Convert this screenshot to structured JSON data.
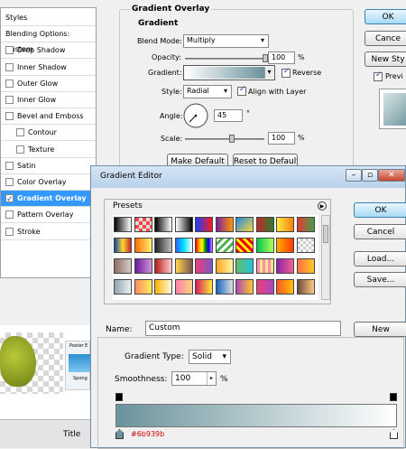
{
  "styles_panel": {
    "items": [
      {
        "label": "Styles",
        "checked": null
      },
      {
        "label": "Blending Options: Custom",
        "checked": null
      },
      {
        "label": "Drop Shadow",
        "checked": false
      },
      {
        "label": "Inner Shadow",
        "checked": false
      },
      {
        "label": "Outer Glow",
        "checked": false
      },
      {
        "label": "Inner Glow",
        "checked": false
      },
      {
        "label": "Bevel and Emboss",
        "checked": false
      },
      {
        "label": "Contour",
        "checked": false
      },
      {
        "label": "Texture",
        "checked": false
      },
      {
        "label": "Satin",
        "checked": false
      },
      {
        "label": "Color Overlay",
        "checked": false
      },
      {
        "label": "Gradient Overlay",
        "checked": true
      },
      {
        "label": "Pattern Overlay",
        "checked": false
      },
      {
        "label": "Stroke",
        "checked": false
      }
    ]
  },
  "gradient_overlay": {
    "title": "Gradient Overlay",
    "section": "Gradient",
    "blend_mode_label": "Blend Mode:",
    "blend_mode": "Multiply",
    "opacity_label": "Opacity:",
    "opacity": "100",
    "opacity_unit": "%",
    "opacity_level": 1.0,
    "gradient_label": "Gradient:",
    "reverse_label": "Reverse",
    "reverse_checked": true,
    "style_label": "Style:",
    "style": "Radial",
    "align_label": "Align with Layer",
    "align_checked": true,
    "angle_label": "Angle:",
    "angle": "45",
    "angle_unit": "°",
    "scale_label": "Scale:",
    "scale": "100",
    "scale_unit": "%",
    "scale_level": 0.5,
    "make_default": "Make Default",
    "reset_default": "Reset to Default"
  },
  "dialog_buttons": {
    "ok": "OK",
    "cancel": "Cance",
    "new_style": "New Sty",
    "preview": "Previ"
  },
  "gradient_editor": {
    "title": "Gradient Editor",
    "presets_label": "Presets",
    "ok": "OK",
    "cancel": "Cancel",
    "load": "Load...",
    "save": "Save...",
    "name_label": "Name:",
    "name_value": "Custom",
    "new_button": "New",
    "gradient_type_label": "Gradient Type:",
    "gradient_type": "Solid",
    "smoothness_label": "Smoothness:",
    "smoothness_value": "100",
    "smoothness_unit": "%",
    "color_stop_hex": "#6b939b"
  },
  "background": {
    "thumb_label_1": "Poster E",
    "thumb_label_2": "Spong",
    "title_col": "Title"
  },
  "colors": {
    "gradient_start": "#6b939b",
    "gradient_end": "#ffffff",
    "selection": "#3399ff"
  }
}
